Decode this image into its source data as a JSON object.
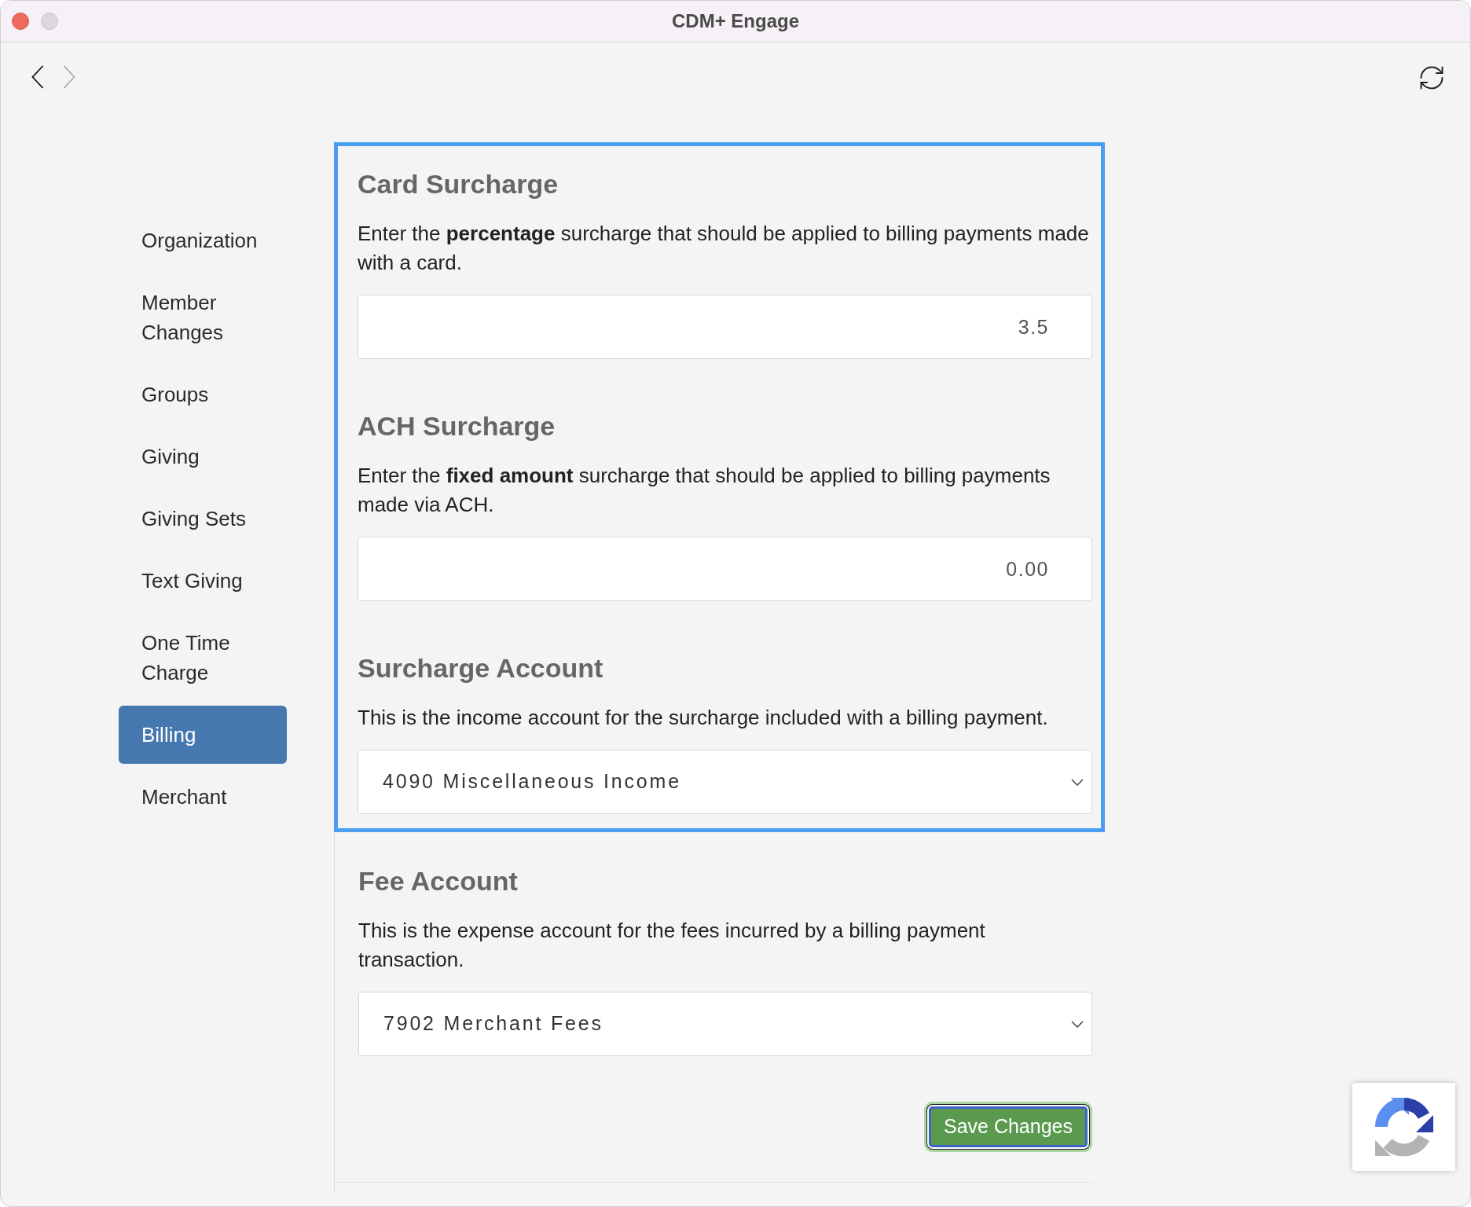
{
  "window": {
    "title": "CDM+ Engage"
  },
  "nav_buttons": [
    {
      "kind": "back",
      "disabled": false
    },
    {
      "kind": "forward",
      "disabled": true
    }
  ],
  "sidebar": {
    "items": [
      {
        "label": "Organization",
        "selected": false
      },
      {
        "label": "Member Changes",
        "selected": false
      },
      {
        "label": "Groups",
        "selected": false
      },
      {
        "label": "Giving",
        "selected": false
      },
      {
        "label": "Giving Sets",
        "selected": false
      },
      {
        "label": "Text Giving",
        "selected": false
      },
      {
        "label": "One Time Charge",
        "selected": false
      },
      {
        "label": "Billing",
        "selected": true
      },
      {
        "label": "Merchant",
        "selected": false
      }
    ]
  },
  "sections": [
    {
      "title": "Card Surcharge",
      "description": "Enter the **percentage** surcharge that should be applied to billing payments made with a card.",
      "field": {
        "kind": "input",
        "value": "3.5"
      },
      "highlighted": true
    },
    {
      "title": "ACH Surcharge",
      "description": "Enter the **fixed amount** surcharge that should be applied to billing payments made via ACH.",
      "field": {
        "kind": "input",
        "value": "0.00"
      },
      "highlighted": true
    },
    {
      "title": "Surcharge Account",
      "description": "This is the income account for the surcharge included with a billing payment.",
      "field": {
        "kind": "select",
        "value": "4090 Miscellaneous Income"
      },
      "highlighted": true
    },
    {
      "title": "Fee Account",
      "description": "This is the expense account for the fees incurred by a billing payment transaction.",
      "field": {
        "kind": "select",
        "value": "7902 Merchant Fees"
      },
      "highlighted": false
    }
  ],
  "save_button": {
    "label": "Save Changes",
    "focused": true
  }
}
